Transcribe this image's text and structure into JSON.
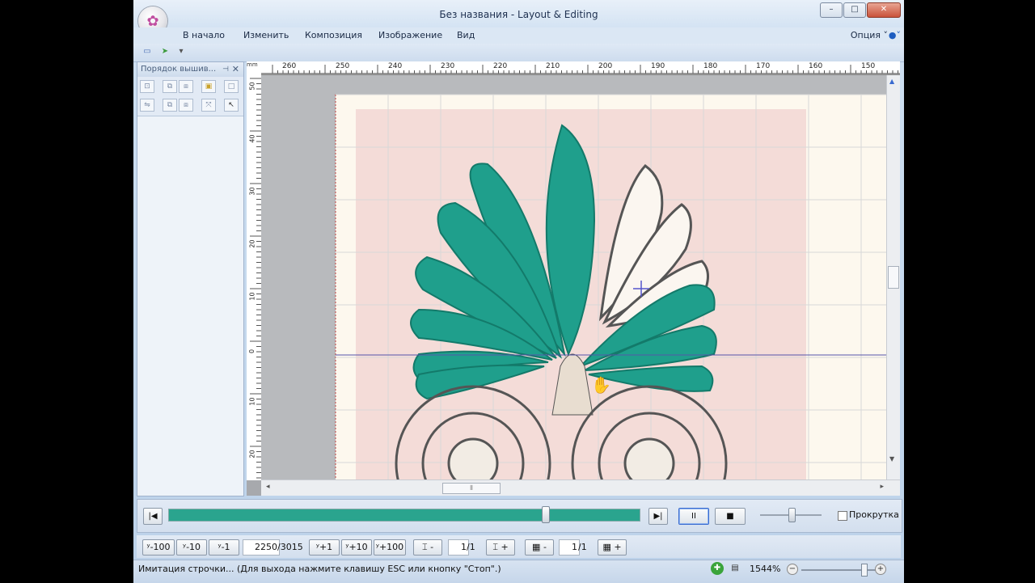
{
  "window": {
    "title": "Без названия - Layout & Editing",
    "min": "–",
    "max": "□",
    "close": "✕"
  },
  "ribbon": {
    "tabs": [
      "В начало",
      "Изменить",
      "Композиция",
      "Изображение",
      "Вид"
    ],
    "option_label": "Опция"
  },
  "left_panel": {
    "title": "Порядок вышив..."
  },
  "rulers": {
    "top": [
      "260",
      "250",
      "240",
      "230",
      "220",
      "210",
      "200",
      "190",
      "180",
      "170",
      "160",
      "150"
    ],
    "left": [
      "50",
      "40",
      "30",
      "20",
      "10",
      "0",
      "10",
      "20"
    ],
    "corner": "mm"
  },
  "playback": {
    "progress": 0.8,
    "pause_label": "II",
    "stop_label": "■",
    "scroll_checkbox_label": "Прокрутка"
  },
  "steps": {
    "minus100": "-100",
    "minus10": "-10",
    "minus1": "-1",
    "current": "2250",
    "total": "/3015",
    "plus1": "+1",
    "plus10": "+10",
    "plus100": "+100",
    "page1_value": "1",
    "page1_total": "/1",
    "page2_value": "1",
    "page2_total": "/1",
    "dec": "-",
    "inc": "+"
  },
  "status": {
    "message": "Имитация строчки... (Для выхода нажмите клавишу ESC или кнопку \"Стоп\".)",
    "zoom": "1544%"
  },
  "colors": {
    "stitch": "#1f9f8c",
    "progress": "#2aa48e"
  }
}
